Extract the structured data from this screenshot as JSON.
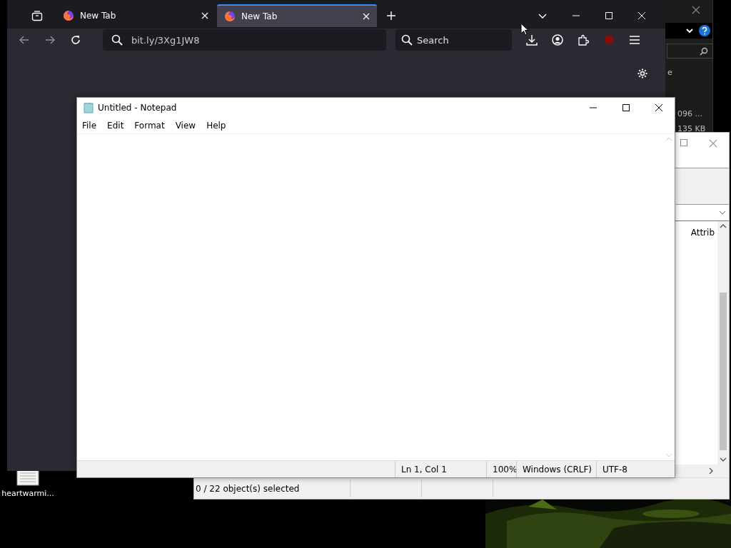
{
  "desktop": {
    "icons": [
      {
        "label": "heartwarmi..."
      }
    ]
  },
  "back_window": {
    "side_letter": "e",
    "texts": [
      "096 ...",
      "135 KB"
    ]
  },
  "explorer": {
    "column_header": "Attrib",
    "status": "0 / 22 object(s) selected"
  },
  "browser": {
    "tabs": [
      {
        "title": "New Tab",
        "selected": false
      },
      {
        "title": "New Tab",
        "selected": true
      }
    ],
    "url": "bit.ly/3Xg1JW8",
    "search": {
      "placeholder": "Search"
    }
  },
  "notepad": {
    "title": "Untitled - Notepad",
    "menu": [
      "File",
      "Edit",
      "Format",
      "View",
      "Help"
    ],
    "status": {
      "position": "Ln 1, Col 1",
      "zoom": "100%",
      "line_endings": "Windows (CRLF)",
      "encoding": "UTF-8"
    }
  }
}
